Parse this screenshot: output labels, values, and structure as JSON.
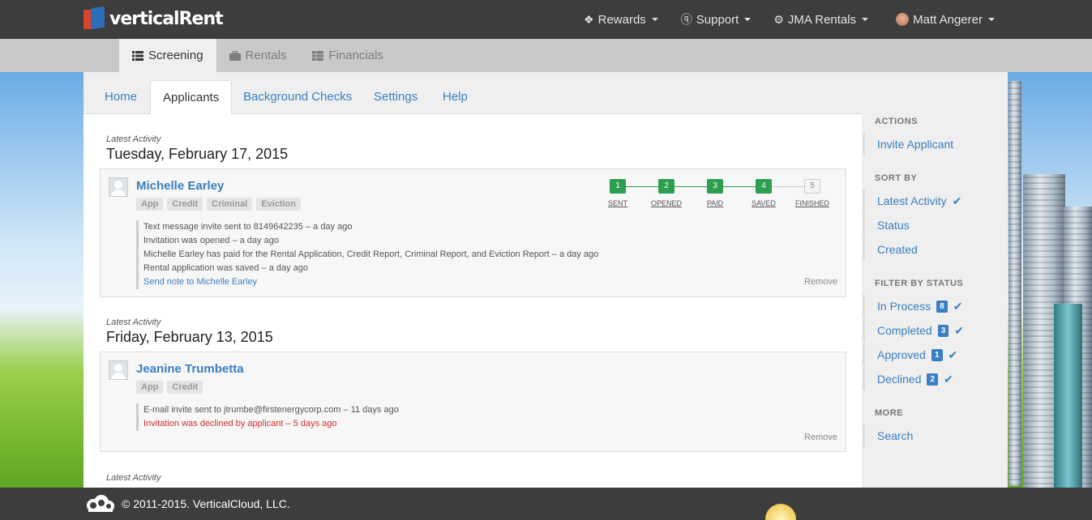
{
  "topbar": {
    "brand": "verticalRent",
    "nav": [
      {
        "icon": "gift-icon",
        "label": "Rewards"
      },
      {
        "icon": "question-circle-icon",
        "label": "Support"
      },
      {
        "icon": "gear-icon",
        "label": "JMA Rentals"
      },
      {
        "icon": "avatar-icon",
        "label": "Matt Angerer"
      }
    ]
  },
  "modules": [
    {
      "icon": "home-icon",
      "label": ""
    },
    {
      "icon": "list-icon",
      "label": "Screening",
      "active": true
    },
    {
      "icon": "briefcase-icon",
      "label": "Rentals"
    },
    {
      "icon": "table-icon",
      "label": "Financials"
    }
  ],
  "subtabs": [
    "Home",
    "Applicants",
    "Background Checks",
    "Settings",
    "Help"
  ],
  "activity": [
    {
      "label": "Latest Activity",
      "date": "Tuesday, February 17, 2015",
      "applicant": {
        "name": "Michelle Earley",
        "badges": [
          "App",
          "Credit",
          "Criminal",
          "Eviction"
        ],
        "progress": {
          "steps": [
            {
              "n": "1",
              "label": "SENT",
              "done": true
            },
            {
              "n": "2",
              "label": "OPENED",
              "done": true
            },
            {
              "n": "3",
              "label": "PAID",
              "done": true
            },
            {
              "n": "4",
              "label": "SAVED",
              "done": true
            },
            {
              "n": "5",
              "label": "FINISHED",
              "done": false
            }
          ]
        },
        "log": [
          "Text message invite sent to 8149642235  –  a day ago",
          "Invitation was opened  –  a day ago",
          "Michelle Earley has paid for the Rental Application, Credit Report, Criminal Report, and Eviction Report  –  a day ago",
          "Rental application was saved  –  a day ago"
        ],
        "note_link": "Send note to Michelle Earley",
        "remove": "Remove"
      }
    },
    {
      "label": "Latest Activity",
      "date": "Friday, February 13, 2015",
      "applicant": {
        "name": "Jeanine Trumbetta",
        "badges": [
          "App",
          "Credit"
        ],
        "log": [
          "E-mail invite sent to jtrumbe@firstenergycorp.com  –  11 days ago"
        ],
        "log_red": "Invitation was declined by applicant  –  5 days ago",
        "remove": "Remove"
      }
    },
    {
      "label": "Latest Activity"
    }
  ],
  "sidebar": {
    "actions_title": "ACTIONS",
    "invite": "Invite Applicant",
    "sort_title": "SORT BY",
    "sort": [
      "Latest Activity",
      "Status",
      "Created"
    ],
    "filter_title": "FILTER BY STATUS",
    "filters": [
      {
        "label": "In Process",
        "count": "8"
      },
      {
        "label": "Completed",
        "count": "3"
      },
      {
        "label": "Approved",
        "count": "1"
      },
      {
        "label": "Declined",
        "count": "2"
      }
    ],
    "more_title": "MORE",
    "search": "Search"
  },
  "footer": {
    "copyright": "© 2011-2015. VerticalCloud, LLC."
  },
  "colors": {
    "link": "#3a7fc1",
    "success": "#2e9e50",
    "danger": "#d32f2f",
    "topbar": "#3d3d3d"
  }
}
